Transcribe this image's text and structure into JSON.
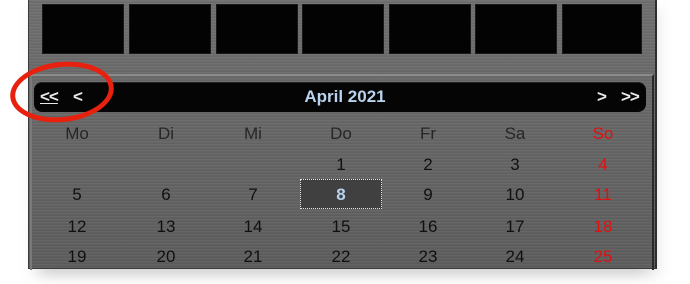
{
  "calendar": {
    "month_title": "April 2021",
    "nav": {
      "prev_year": "<<",
      "prev_month": "<",
      "next_month": ">",
      "next_year": ">>"
    },
    "weekdays": [
      "Mo",
      "Di",
      "Mi",
      "Do",
      "Fr",
      "Sa",
      "So"
    ],
    "weeks": [
      [
        "",
        "",
        "",
        "1",
        "2",
        "3",
        "4"
      ],
      [
        "5",
        "6",
        "7",
        "8",
        "9",
        "10",
        "11"
      ],
      [
        "12",
        "13",
        "14",
        "15",
        "16",
        "17",
        "18"
      ],
      [
        "19",
        "20",
        "21",
        "22",
        "23",
        "24",
        "25"
      ]
    ],
    "selected_day": "8"
  },
  "colors": {
    "weekend": "#e01010",
    "title": "#b9d3ee",
    "highlight_ring": "#e8200e"
  }
}
